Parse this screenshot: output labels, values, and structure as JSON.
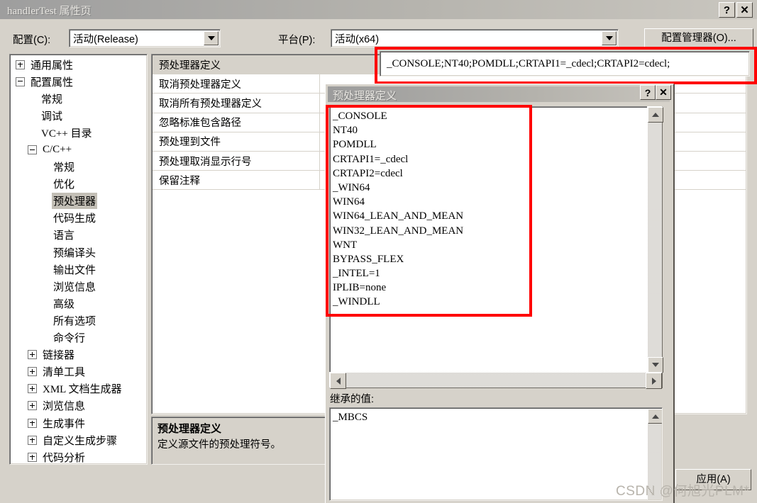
{
  "window": {
    "title": "handlerTest 属性页",
    "help_label": "?",
    "close_label": "✕"
  },
  "config_bar": {
    "config_label": "配置(C):",
    "config_value": "活动(Release)",
    "platform_label": "平台(P):",
    "platform_value": "活动(x64)",
    "config_manager_label": "配置管理器(O)..."
  },
  "tree": {
    "items": [
      {
        "label": "通用属性",
        "indent": 0,
        "expander": "plus",
        "selected": false
      },
      {
        "label": "配置属性",
        "indent": 0,
        "expander": "minus",
        "selected": false
      },
      {
        "label": "常规",
        "indent": 1,
        "expander": "none",
        "selected": false
      },
      {
        "label": "调试",
        "indent": 1,
        "expander": "none",
        "selected": false
      },
      {
        "label": "VC++ 目录",
        "indent": 1,
        "expander": "none",
        "selected": false
      },
      {
        "label": "C/C++",
        "indent": 1,
        "expander": "minus",
        "selected": false
      },
      {
        "label": "常规",
        "indent": 2,
        "expander": "none",
        "selected": false
      },
      {
        "label": "优化",
        "indent": 2,
        "expander": "none",
        "selected": false
      },
      {
        "label": "预处理器",
        "indent": 2,
        "expander": "none",
        "selected": true
      },
      {
        "label": "代码生成",
        "indent": 2,
        "expander": "none",
        "selected": false
      },
      {
        "label": "语言",
        "indent": 2,
        "expander": "none",
        "selected": false
      },
      {
        "label": "预编译头",
        "indent": 2,
        "expander": "none",
        "selected": false
      },
      {
        "label": "输出文件",
        "indent": 2,
        "expander": "none",
        "selected": false
      },
      {
        "label": "浏览信息",
        "indent": 2,
        "expander": "none",
        "selected": false
      },
      {
        "label": "高级",
        "indent": 2,
        "expander": "none",
        "selected": false
      },
      {
        "label": "所有选项",
        "indent": 2,
        "expander": "none",
        "selected": false
      },
      {
        "label": "命令行",
        "indent": 2,
        "expander": "none",
        "selected": false
      },
      {
        "label": "链接器",
        "indent": 1,
        "expander": "plus",
        "selected": false
      },
      {
        "label": "清单工具",
        "indent": 1,
        "expander": "plus",
        "selected": false
      },
      {
        "label": "XML 文档生成器",
        "indent": 1,
        "expander": "plus",
        "selected": false
      },
      {
        "label": "浏览信息",
        "indent": 1,
        "expander": "plus",
        "selected": false
      },
      {
        "label": "生成事件",
        "indent": 1,
        "expander": "plus",
        "selected": false
      },
      {
        "label": "自定义生成步骤",
        "indent": 1,
        "expander": "plus",
        "selected": false
      },
      {
        "label": "代码分析",
        "indent": 1,
        "expander": "plus",
        "selected": false
      }
    ]
  },
  "property_grid": {
    "rows": [
      {
        "name": "预处理器定义",
        "value": ""
      },
      {
        "name": "取消预处理器定义",
        "value": ""
      },
      {
        "name": "取消所有预处理器定义",
        "value": ""
      },
      {
        "name": "忽略标准包含路径",
        "value": ""
      },
      {
        "name": "预处理到文件",
        "value": ""
      },
      {
        "name": "预处理取消显示行号",
        "value": ""
      },
      {
        "name": "保留注释",
        "value": ""
      }
    ],
    "active_value": "_CONSOLE;NT40;POMDLL;CRTAPI1=_cdecl;CRTAPI2=cdecl;"
  },
  "description": {
    "title": "预处理器定义",
    "body": "定义源文件的预处理符号。"
  },
  "footer": {
    "apply_label": "应用(A)"
  },
  "dialog": {
    "title": "预处理器定义",
    "help_label": "?",
    "close_label": "✕",
    "macros": [
      "_CONSOLE",
      "NT40",
      "POMDLL",
      "CRTAPI1=_cdecl",
      "CRTAPI2=cdecl",
      "_WIN64",
      "WIN64",
      "WIN64_LEAN_AND_MEAN",
      "WIN32_LEAN_AND_MEAN",
      "WNT",
      "BYPASS_FLEX",
      "_INTEL=1",
      "IPLIB=none",
      "_WINDLL"
    ],
    "inherited_label": "继承的值:",
    "inherited_values": [
      "_MBCS"
    ]
  },
  "watermark": "CSDN @何旭光PLM*",
  "colors": {
    "face": "#d6d2ca",
    "highlight_box": "#ff0000",
    "selection": "#c3bfb6",
    "titlebar_text": "#e9e7e2"
  }
}
